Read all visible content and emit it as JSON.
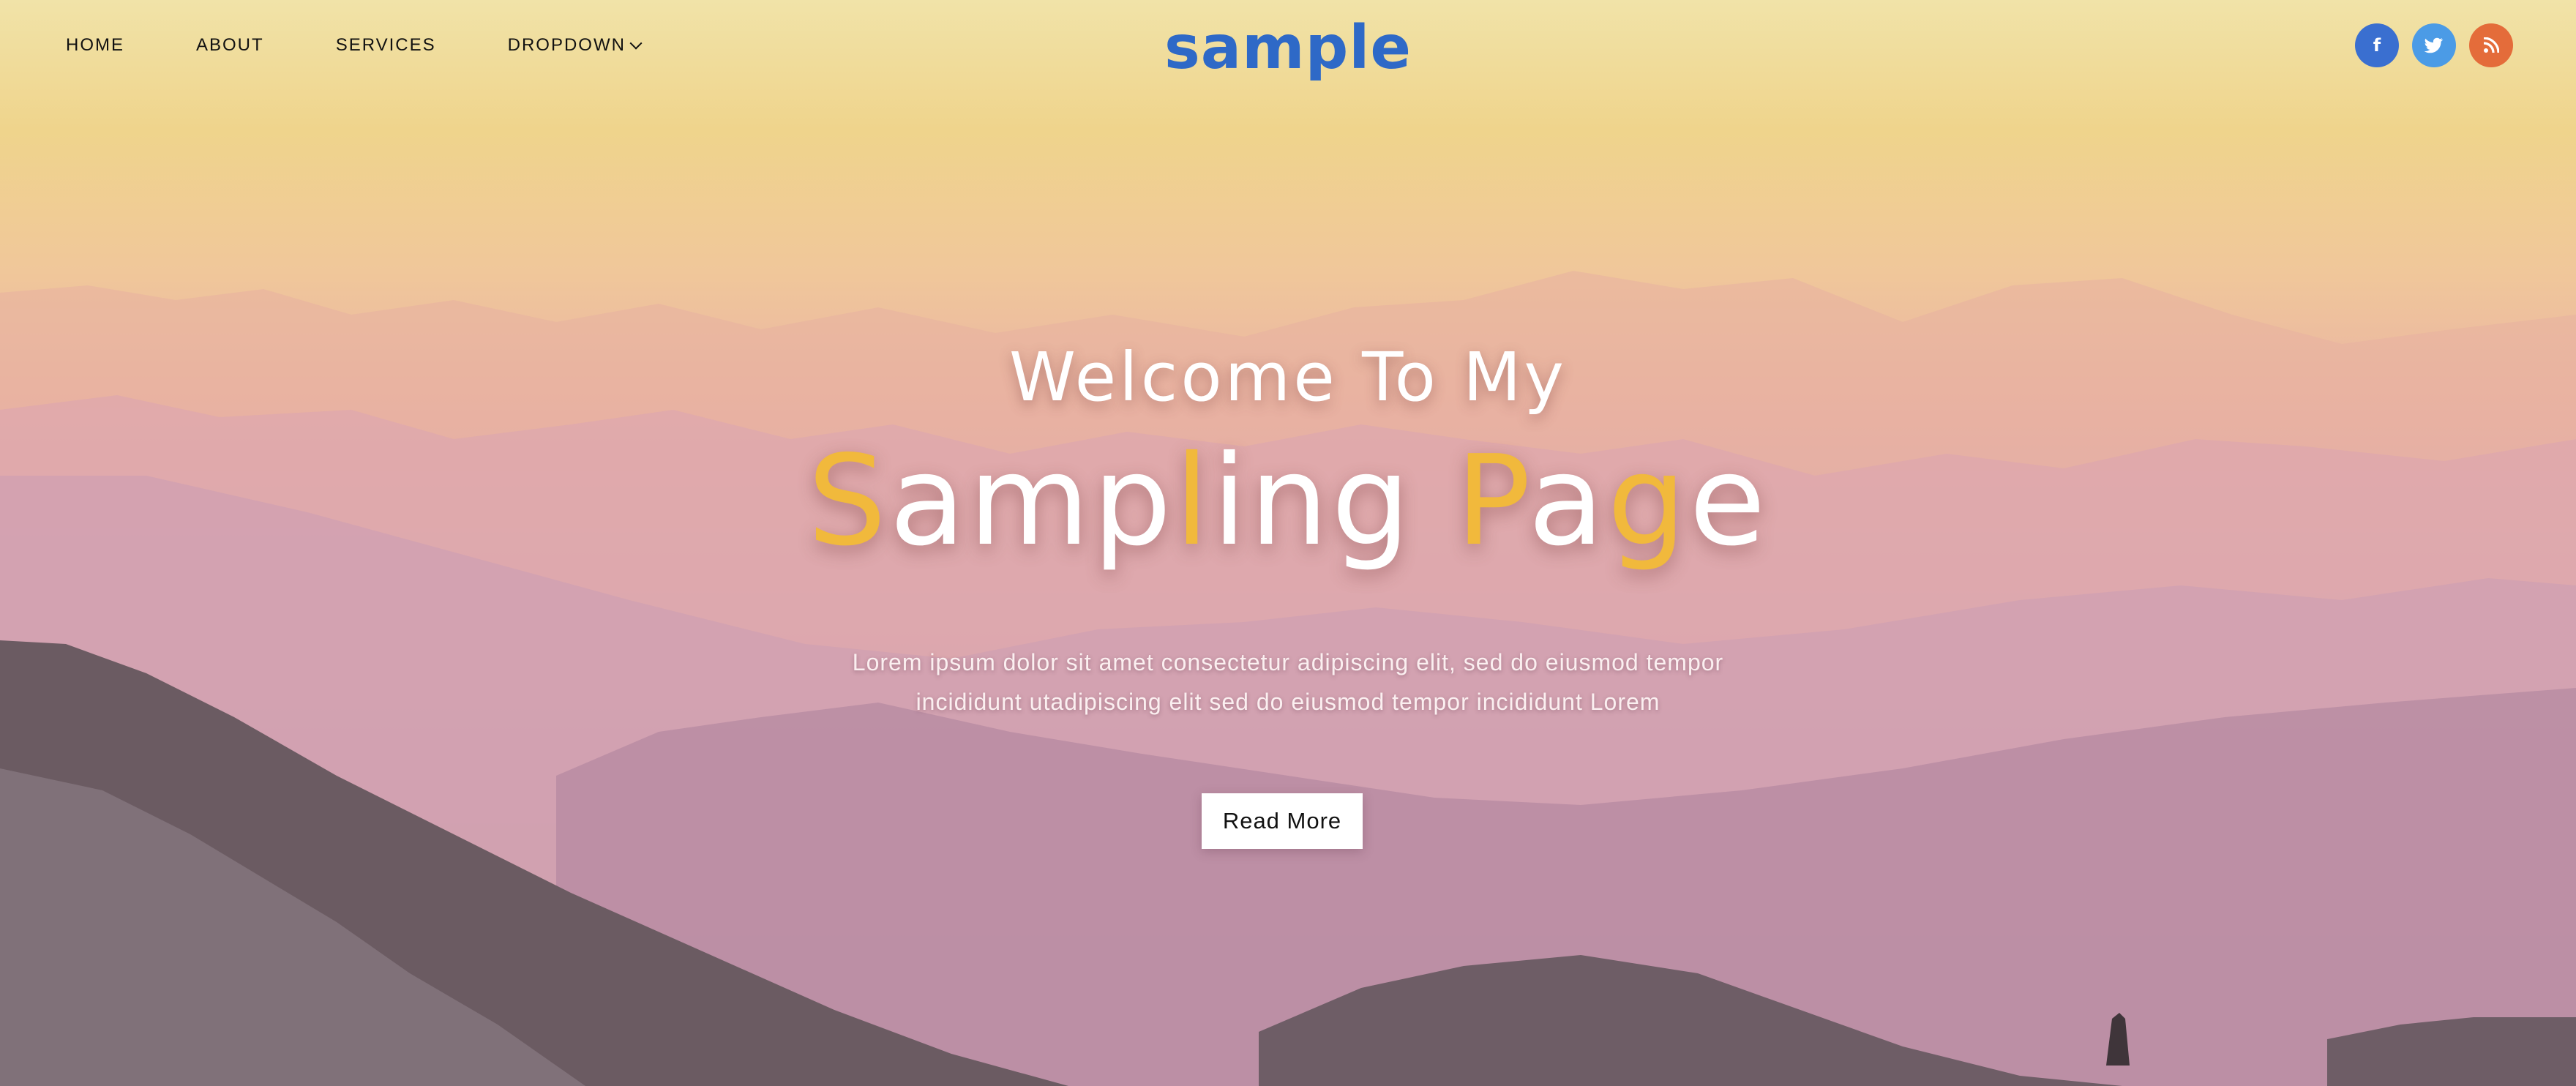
{
  "header": {
    "nav": [
      {
        "label": "HOME"
      },
      {
        "label": "ABOUT"
      },
      {
        "label": "SERVICES"
      },
      {
        "label": "DROPDOWN"
      }
    ],
    "logo": "sample",
    "social": [
      {
        "icon": "facebook-icon",
        "glyph": "f",
        "color": "#3a6fd0"
      },
      {
        "icon": "twitter-icon",
        "glyph": "t",
        "color": "#4b9be6"
      },
      {
        "icon": "rss-icon",
        "glyph": "≈",
        "color": "#e46c3a"
      }
    ]
  },
  "hero": {
    "welcome": "Welcome To My",
    "headline": "Sampling Page",
    "headline_parts": [
      {
        "text": "S",
        "gold": true
      },
      {
        "text": "amp",
        "gold": false
      },
      {
        "text": "l",
        "gold": true
      },
      {
        "text": "ing ",
        "gold": false
      },
      {
        "text": "P",
        "gold": true
      },
      {
        "text": "a",
        "gold": false
      },
      {
        "text": "g",
        "gold": true
      },
      {
        "text": "e",
        "gold": false
      }
    ],
    "lead_line1": "Lorem ipsum dolor sit amet consectetur adipiscing elit, sed do eiusmod tempor",
    "lead_line2": "incididunt utadipiscing elit sed do eiusmod tempor incididunt Lorem",
    "button": "Read More"
  },
  "colors": {
    "accent": "#2e69c7",
    "gold": "#f1b93c"
  }
}
